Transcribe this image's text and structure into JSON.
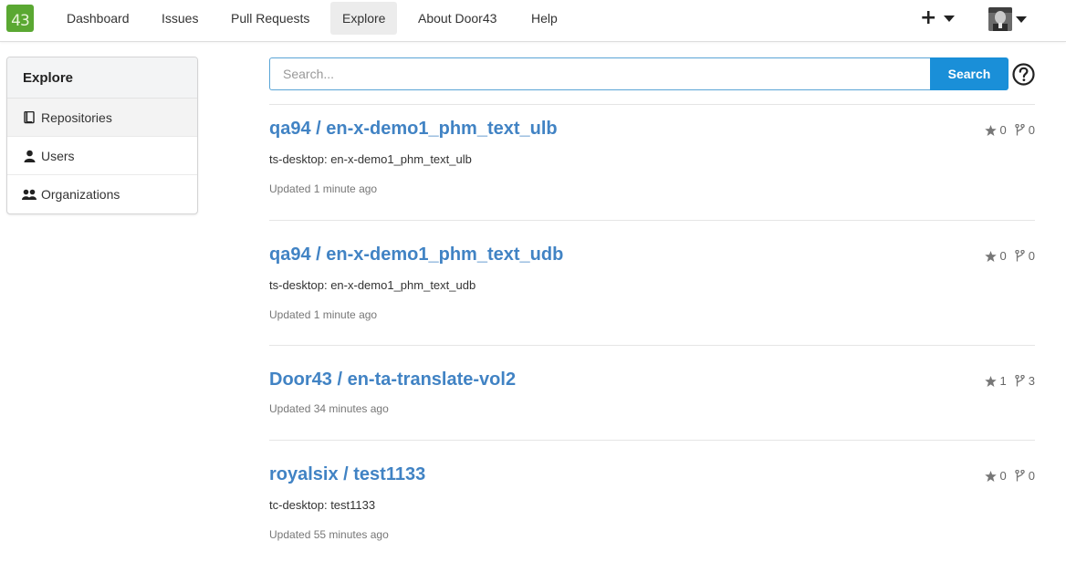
{
  "nav": {
    "logo_text": "43",
    "items": [
      {
        "label": "Dashboard"
      },
      {
        "label": "Issues"
      },
      {
        "label": "Pull Requests"
      },
      {
        "label": "Explore"
      },
      {
        "label": "About Door43"
      },
      {
        "label": "Help"
      }
    ],
    "active_index": 3
  },
  "sidebar": {
    "header": "Explore",
    "items": [
      {
        "label": "Repositories",
        "icon": "repo-icon"
      },
      {
        "label": "Users",
        "icon": "person-icon"
      },
      {
        "label": "Organizations",
        "icon": "organization-icon"
      }
    ],
    "active_index": 0
  },
  "search": {
    "placeholder": "Search...",
    "value": "",
    "button_label": "Search"
  },
  "repos": [
    {
      "title": "qa94 / en-x-demo1_phm_text_ulb",
      "description": "ts-desktop: en-x-demo1_phm_text_ulb",
      "updated": "Updated 1 minute ago",
      "stars": "0",
      "forks": "0"
    },
    {
      "title": "qa94 / en-x-demo1_phm_text_udb",
      "description": "ts-desktop: en-x-demo1_phm_text_udb",
      "updated": "Updated 1 minute ago",
      "stars": "0",
      "forks": "0"
    },
    {
      "title": "Door43 / en-ta-translate-vol2",
      "description": "",
      "updated": "Updated 34 minutes ago",
      "stars": "1",
      "forks": "3"
    },
    {
      "title": "royalsix / test1133",
      "description": "tc-desktop: test1133",
      "updated": "Updated 55 minutes ago",
      "stars": "0",
      "forks": "0"
    }
  ],
  "colors": {
    "link": "#4183c4",
    "search_button": "#1a8fd8",
    "logo_green": "#5aa832",
    "active_bg": "#ececec"
  }
}
